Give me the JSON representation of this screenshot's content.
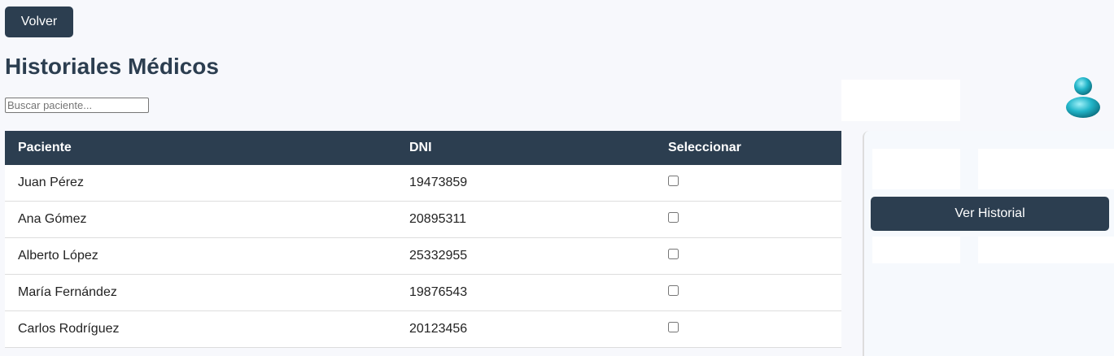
{
  "header": {
    "back_label": "Volver",
    "title": "Historiales Médicos",
    "search_placeholder": "Buscar paciente..."
  },
  "table": {
    "columns": [
      "Paciente",
      "DNI",
      "Seleccionar"
    ],
    "rows": [
      {
        "name": "Juan Pérez",
        "dni": "19473859"
      },
      {
        "name": "Ana Gómez",
        "dni": "20895311"
      },
      {
        "name": "Alberto López",
        "dni": "25332955"
      },
      {
        "name": "María Fernández",
        "dni": "19876543"
      },
      {
        "name": "Carlos Rodríguez",
        "dni": "20123456"
      }
    ]
  },
  "panel": {
    "view_label": "Ver Historial"
  }
}
